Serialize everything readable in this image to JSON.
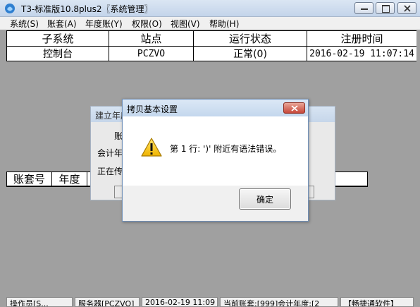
{
  "window": {
    "title": "T3-标准版10.8plus2〖系统管理〗",
    "minimize_symbol": "–",
    "maximize_symbol": "□",
    "close_symbol": "✕"
  },
  "menu": [
    "系统(S)",
    "账套(A)",
    "年度账(Y)",
    "权限(O)",
    "视图(V)",
    "帮助(H)"
  ],
  "system_table": {
    "headers": [
      "子系统",
      "站点",
      "运行状态",
      "注册时间"
    ],
    "rows": [
      [
        "控制台",
        "PCZVO",
        "正常(0)",
        "2016-02-19 11:07:14"
      ]
    ]
  },
  "account_table": {
    "headers": [
      "账套号",
      "年度"
    ]
  },
  "background_dialog": {
    "title": "建立年度",
    "label1": "账",
    "label2": "会计年",
    "label3": "正在传"
  },
  "message_box": {
    "title": "拷贝基本设置",
    "message": "第 1 行: ')' 附近有语法错误。",
    "ok_label": "确定",
    "icon": "warning-icon"
  },
  "status_bar": {
    "operator": "操作员[S...",
    "server": "服务器[PCZVO]",
    "datetime": "2016-02-19 11:09",
    "current_account": "当前账套:[999]会计年度:[2",
    "brand": "【畅捷通软件】"
  }
}
